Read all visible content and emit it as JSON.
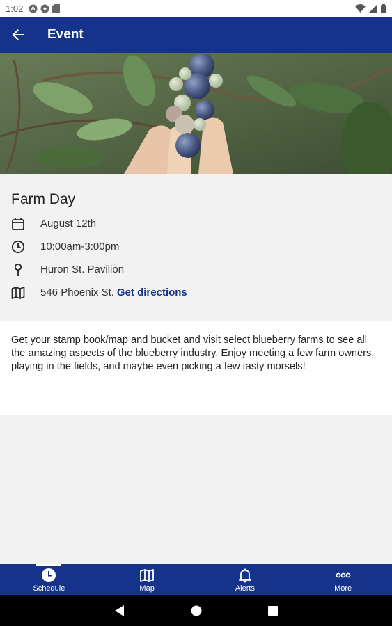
{
  "status_bar": {
    "time": "1:02"
  },
  "header": {
    "title": "Event"
  },
  "event": {
    "title": "Farm Day",
    "date": "August 12th",
    "time": "10:00am-3:00pm",
    "venue": "Huron St. Pavilion",
    "address": "546 Phoenix St.",
    "directions_label": "Get directions",
    "description": "Get your stamp book/map and bucket and visit select blueberry farms to see all the amazing aspects of the blueberry industry. Enjoy meeting a few farm owners, playing in the fields, and maybe even picking a few tasty morsels!"
  },
  "bottom_nav": {
    "items": [
      {
        "label": "Schedule",
        "icon": "clock-icon",
        "active": true
      },
      {
        "label": "Map",
        "icon": "map-icon",
        "active": false
      },
      {
        "label": "Alerts",
        "icon": "bell-icon",
        "active": false
      },
      {
        "label": "More",
        "icon": "more-dots-icon",
        "active": false
      }
    ]
  },
  "colors": {
    "brand": "#16338b",
    "link": "#16338b",
    "background": "#f1f1f1"
  }
}
